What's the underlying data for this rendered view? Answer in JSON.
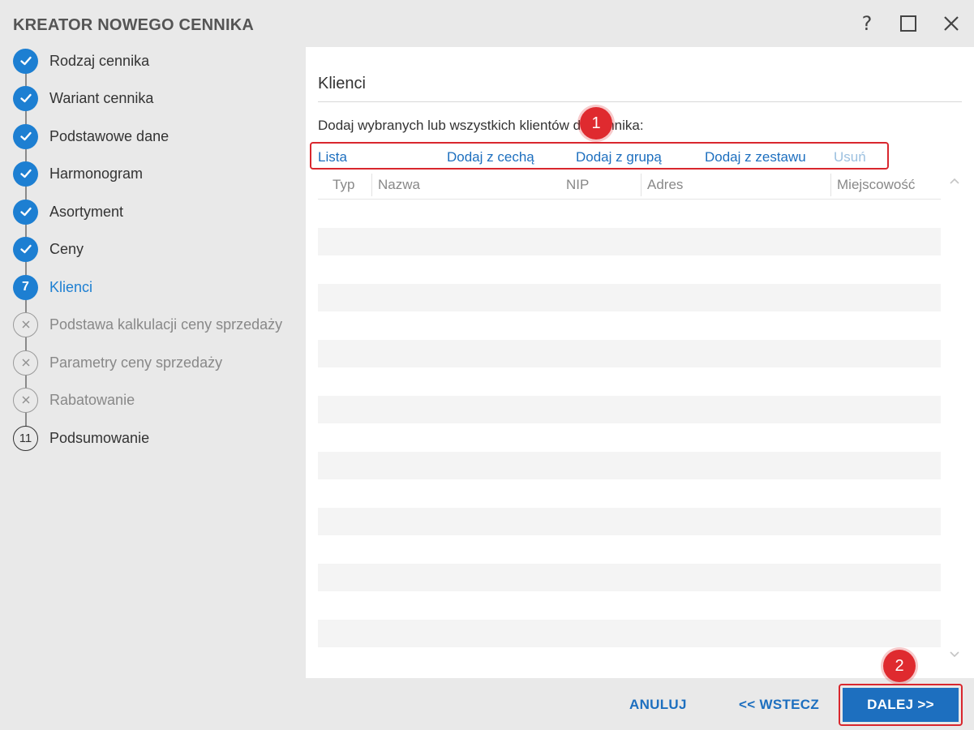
{
  "window": {
    "title": "KREATOR NOWEGO CENNIKA",
    "help_label": "?"
  },
  "steps": [
    {
      "number": "1",
      "label": "Rodzaj cennika",
      "state": "done"
    },
    {
      "number": "2",
      "label": "Wariant cennika",
      "state": "done"
    },
    {
      "number": "3",
      "label": "Podstawowe dane",
      "state": "done"
    },
    {
      "number": "4",
      "label": "Harmonogram",
      "state": "done"
    },
    {
      "number": "5",
      "label": "Asortyment",
      "state": "done"
    },
    {
      "number": "6",
      "label": "Ceny",
      "state": "done"
    },
    {
      "number": "7",
      "label": "Klienci",
      "state": "active"
    },
    {
      "number": "8",
      "label": "Podstawa kalkulacji ceny sprzedaży",
      "state": "todo"
    },
    {
      "number": "9",
      "label": "Parametry ceny sprzedaży",
      "state": "todo"
    },
    {
      "number": "10",
      "label": "Rabatowanie",
      "state": "todo"
    },
    {
      "number": "11",
      "label": "Podsumowanie",
      "state": "pending"
    }
  ],
  "main": {
    "section_title": "Klienci",
    "instruction": "Dodaj wybranych lub wszystkich klientów do cennika:",
    "actions": {
      "list": "Lista",
      "add_feature": "Dodaj z cechą",
      "add_group": "Dodaj z grupą",
      "add_set": "Dodaj z zestawu",
      "remove": "Usuń"
    },
    "grid": {
      "columns": [
        "Typ",
        "Nazwa",
        "NIP",
        "Adres",
        "Miejscowość"
      ],
      "rows": []
    }
  },
  "annotations": {
    "marker_1": "1",
    "marker_2": "2"
  },
  "footer": {
    "cancel": "ANULUJ",
    "back": "<< WSTECZ",
    "next": "DALEJ >>"
  },
  "colors": {
    "accent": "#1d7fd2",
    "link": "#1d6fbf",
    "highlight": "#d9272e",
    "background": "#e9e9e9"
  }
}
